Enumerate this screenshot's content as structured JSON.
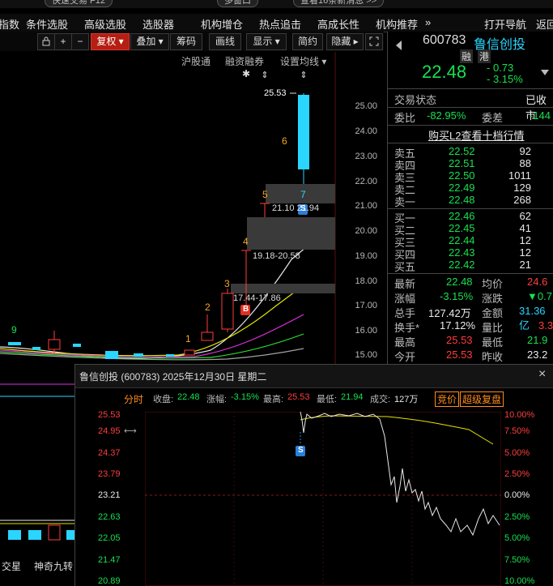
{
  "top_bar": {
    "pill1": "快速交易 F12",
    "pill2": "多窗口",
    "pill3": "查看16条新消息 >>"
  },
  "menu": {
    "items": [
      "指数",
      "条件选股",
      "高级选股",
      "选股器",
      "机构增仓",
      "热点追击",
      "高成长性",
      "机构推荐",
      "»",
      "打开导航",
      "返回"
    ]
  },
  "toolbar": {
    "fuquan": "复权 ▾",
    "diejia": "叠加 ▾",
    "choumа": "筹码",
    "huaxian": "画线",
    "xianshi": "显示 ▾",
    "jianyue": "简约",
    "yincang": "隐藏 ▸",
    "plus": "+",
    "minus": "−"
  },
  "subtoolbar": {
    "hugutong": "沪股通",
    "rongzi": "融资融券",
    "shezhi": "设置均线 ▾"
  },
  "chart": {
    "y_ticks": [
      "25.00",
      "24.00",
      "23.00",
      "22.00",
      "21.00",
      "20.00",
      "19.00",
      "18.00",
      "17.00",
      "16.00",
      "15.00"
    ],
    "annotations": {
      "high_label": "25.53",
      "zone1": "21.10 21.94",
      "zone2": "19.18-20.58",
      "zone3": "17.44-17.86",
      "n1": "1",
      "n2": "2",
      "n3": "3",
      "n4": "4",
      "n5": "5",
      "n6": "6",
      "n7": "7",
      "n9": "9",
      "s_marker": "S",
      "b_marker": "B"
    }
  },
  "quote": {
    "code": "600783",
    "name": "鲁信创投",
    "tag1": "融",
    "tag2": "港",
    "price": "22.48",
    "change": "- 0.73",
    "change_pct": "- 3.15%",
    "trade_status_label": "交易状态",
    "trade_status": "已收市",
    "weibi_label": "委比",
    "weibi": "-82.95%",
    "weicha_label": "委差",
    "weicha": "-144",
    "l2_link": "购买L2查看十档行情",
    "asks": [
      {
        "label": "卖五",
        "price": "22.52",
        "vol": "92"
      },
      {
        "label": "卖四",
        "price": "22.51",
        "vol": "88"
      },
      {
        "label": "卖三",
        "price": "22.50",
        "vol": "1011"
      },
      {
        "label": "卖二",
        "price": "22.49",
        "vol": "129"
      },
      {
        "label": "卖一",
        "price": "22.48",
        "vol": "268"
      }
    ],
    "bids": [
      {
        "label": "买一",
        "price": "22.46",
        "vol": "62"
      },
      {
        "label": "买二",
        "price": "22.45",
        "vol": "41"
      },
      {
        "label": "买三",
        "price": "22.44",
        "vol": "12"
      },
      {
        "label": "买四",
        "price": "22.43",
        "vol": "12"
      },
      {
        "label": "买五",
        "price": "22.42",
        "vol": "21"
      }
    ],
    "stats": [
      {
        "l1": "最新",
        "v1": "22.48",
        "l2": "均价",
        "v2": "24.6"
      },
      {
        "l1": "涨幅",
        "v1": "-3.15%",
        "l2": "涨跌",
        "v2": "▼0.7"
      },
      {
        "l1": "总手",
        "v1": "127.42万",
        "l2": "金额",
        "v2": "31.36亿"
      },
      {
        "l1": "换手*",
        "v1": "17.12%",
        "l2": "量比",
        "v2": "3.3"
      },
      {
        "l1": "最高",
        "v1": "25.53",
        "l2": "最低",
        "v2": "21.9"
      },
      {
        "l1": "今开",
        "v1": "25.53",
        "l2": "昨收",
        "v2": "23.2"
      }
    ]
  },
  "popup": {
    "title": "鲁信创投 (600783)  2025年12月30日 星期二",
    "close": "×",
    "fenshi": "分时",
    "shoupan_label": "收盘:",
    "shoupan": "22.48",
    "zhangfu_label": "涨幅:",
    "zhangfu": "-3.15%",
    "zuigao_label": "最高:",
    "zuigao": "25.53",
    "zuidi_label": "最低:",
    "zuidi": "21.94",
    "chengjiao_label": "成交:",
    "chengjiao": "127万",
    "jingjia": "竞价",
    "chaoji": "超级复盘",
    "left_ticks": [
      "25.53",
      "24.95",
      "24.37",
      "23.79",
      "23.21",
      "22.63",
      "22.05",
      "21.47",
      "20.89"
    ],
    "right_ticks": [
      "10.00%",
      "7.50%",
      "5.00%",
      "2.50%",
      "0.00%",
      "2.50%",
      "5.00%",
      "7.50%",
      "10.00%"
    ],
    "s_marker": "S"
  },
  "bottom_tabs": {
    "tab1": "交星",
    "tab2": "神奇九转"
  }
}
